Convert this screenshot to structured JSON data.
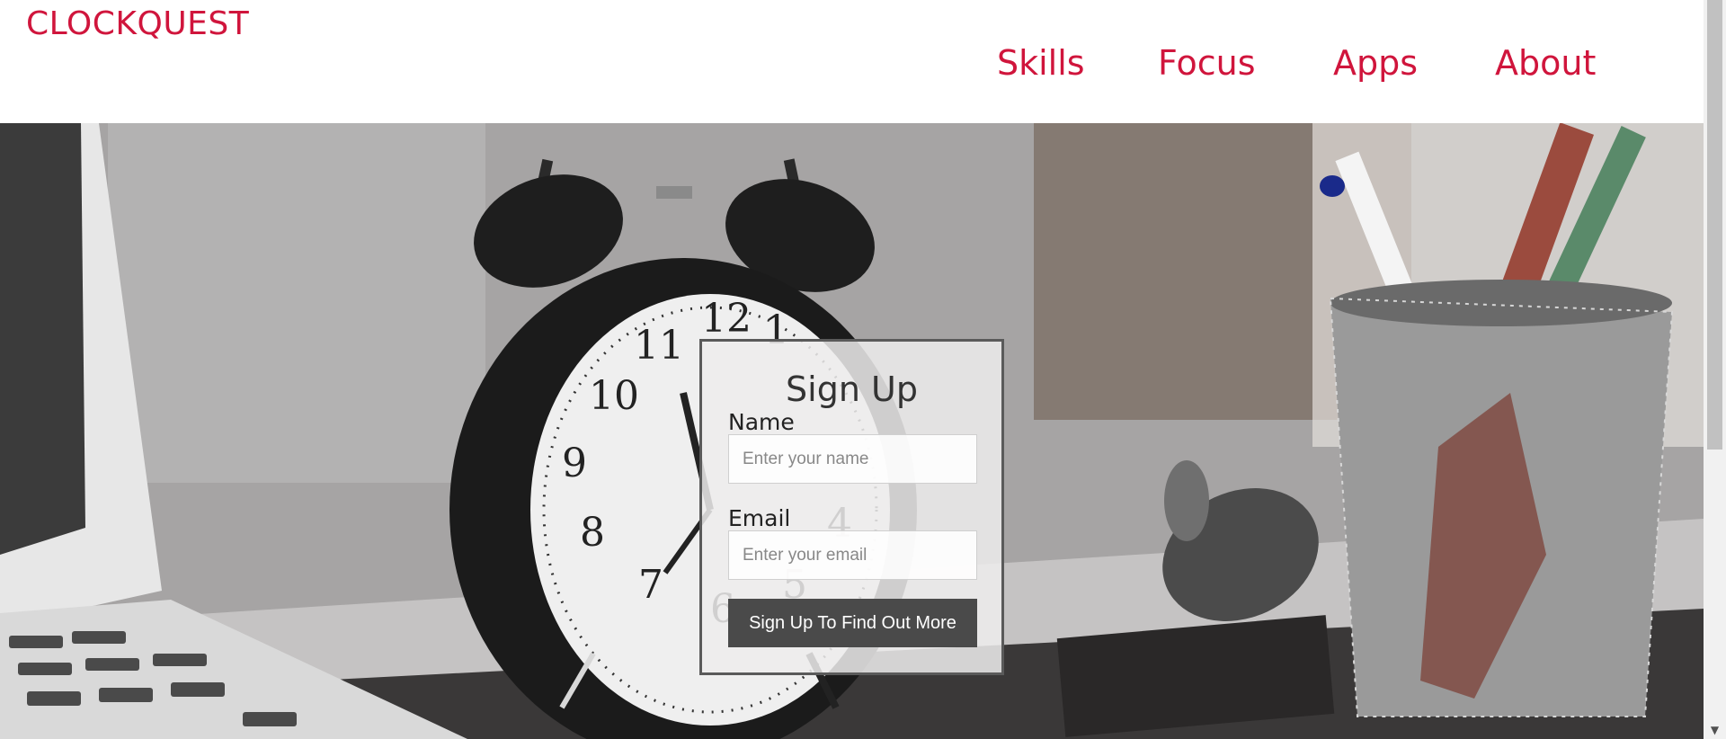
{
  "header": {
    "brand": "CLOCKQUEST",
    "nav": [
      {
        "label": "Skills"
      },
      {
        "label": "Focus"
      },
      {
        "label": "Apps"
      },
      {
        "label": "About"
      }
    ]
  },
  "signup": {
    "title": "Sign Up",
    "name_label": "Name",
    "name_placeholder": "Enter your name",
    "email_label": "Email",
    "email_placeholder": "Enter your email",
    "button_label": "Sign Up To Find Out More"
  },
  "clock_numerals": [
    "12",
    "1",
    "11",
    "10",
    "9",
    "8",
    "7",
    "6",
    "5",
    "4"
  ],
  "colors": {
    "brand": "#d0153c",
    "button": "#4a4a4a",
    "card_border": "#5a5a5a"
  },
  "icons": {
    "scroll_down": "chevron-down-icon"
  }
}
